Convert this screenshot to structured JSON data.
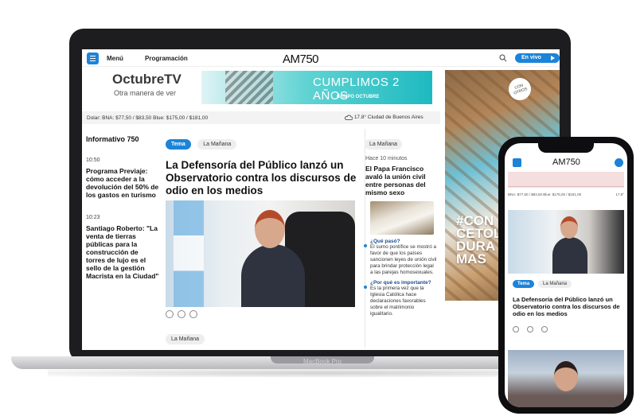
{
  "site": {
    "logo": "AM750",
    "nav": {
      "menu_label": "Menú",
      "programming_label": "Programación",
      "live_label": "En vivo"
    }
  },
  "banner": {
    "brand": "OctubreTV",
    "tagline": "Otra manera de ver",
    "headline": "CUMPLIMOS 2 AÑOS",
    "group": "GRUPO OCTUBRE"
  },
  "rates": {
    "text": "Dolar: BNA: $77,50 / $83,50   Blue: $175,00 / $181,00",
    "weather": "17.8° Ciudad de Buenos Aires"
  },
  "left": {
    "title": "Informativo 750",
    "items": [
      {
        "time": "10:50",
        "headline": "Programa Previaje: cómo acceder a la devolución del 50% de los gastos en turismo"
      },
      {
        "time": "10:23",
        "headline": "Santiago Roberto: \"La venta de tierras públicas para la construcción de torres de lujo es el sello de la gestión Macrista en la Ciudad\""
      }
    ]
  },
  "main": {
    "tag_primary": "Tema",
    "tag_secondary": "La Mañana",
    "headline": "La Defensoría del Público lanzó un Observatorio contra los discursos de odio en los medios",
    "next_tag": "La Mañana"
  },
  "right": {
    "tag": "La Mañana",
    "ago": "Hace 10 minutos",
    "headline": "El Papa Francisco avaló la unión civil entre personas del mismo sexo",
    "qa": [
      {
        "q": "¿Qué pasó?",
        "a": "El sumo pontífice se mostró a favor de que los países sancionen leyes de unión civil para brindar protección legal a las parejas homosexuales."
      },
      {
        "q": "¿Por qué es importante?",
        "a": "Es la primera vez que la Iglesia Católica hace declaraciones favorables sobre el matrimonio igualitario."
      }
    ]
  },
  "side_ad": {
    "badge": "CON OTROS",
    "text": "#CON CETOL DURA MAS"
  },
  "laptop_label": "MacBook Pro",
  "phone": {
    "logo": "AM750",
    "rates": "BNA: $77,50 / $83,50   Blue: $175,00 / $181,00",
    "temp": "17.8°",
    "tag_primary": "Tema",
    "tag_secondary": "La Mañana",
    "headline": "La Defensoría del Público lanzó un Observatorio contra los discursos de odio en los medios"
  },
  "colors": {
    "accent": "#1c83d8",
    "text": "#111111"
  }
}
